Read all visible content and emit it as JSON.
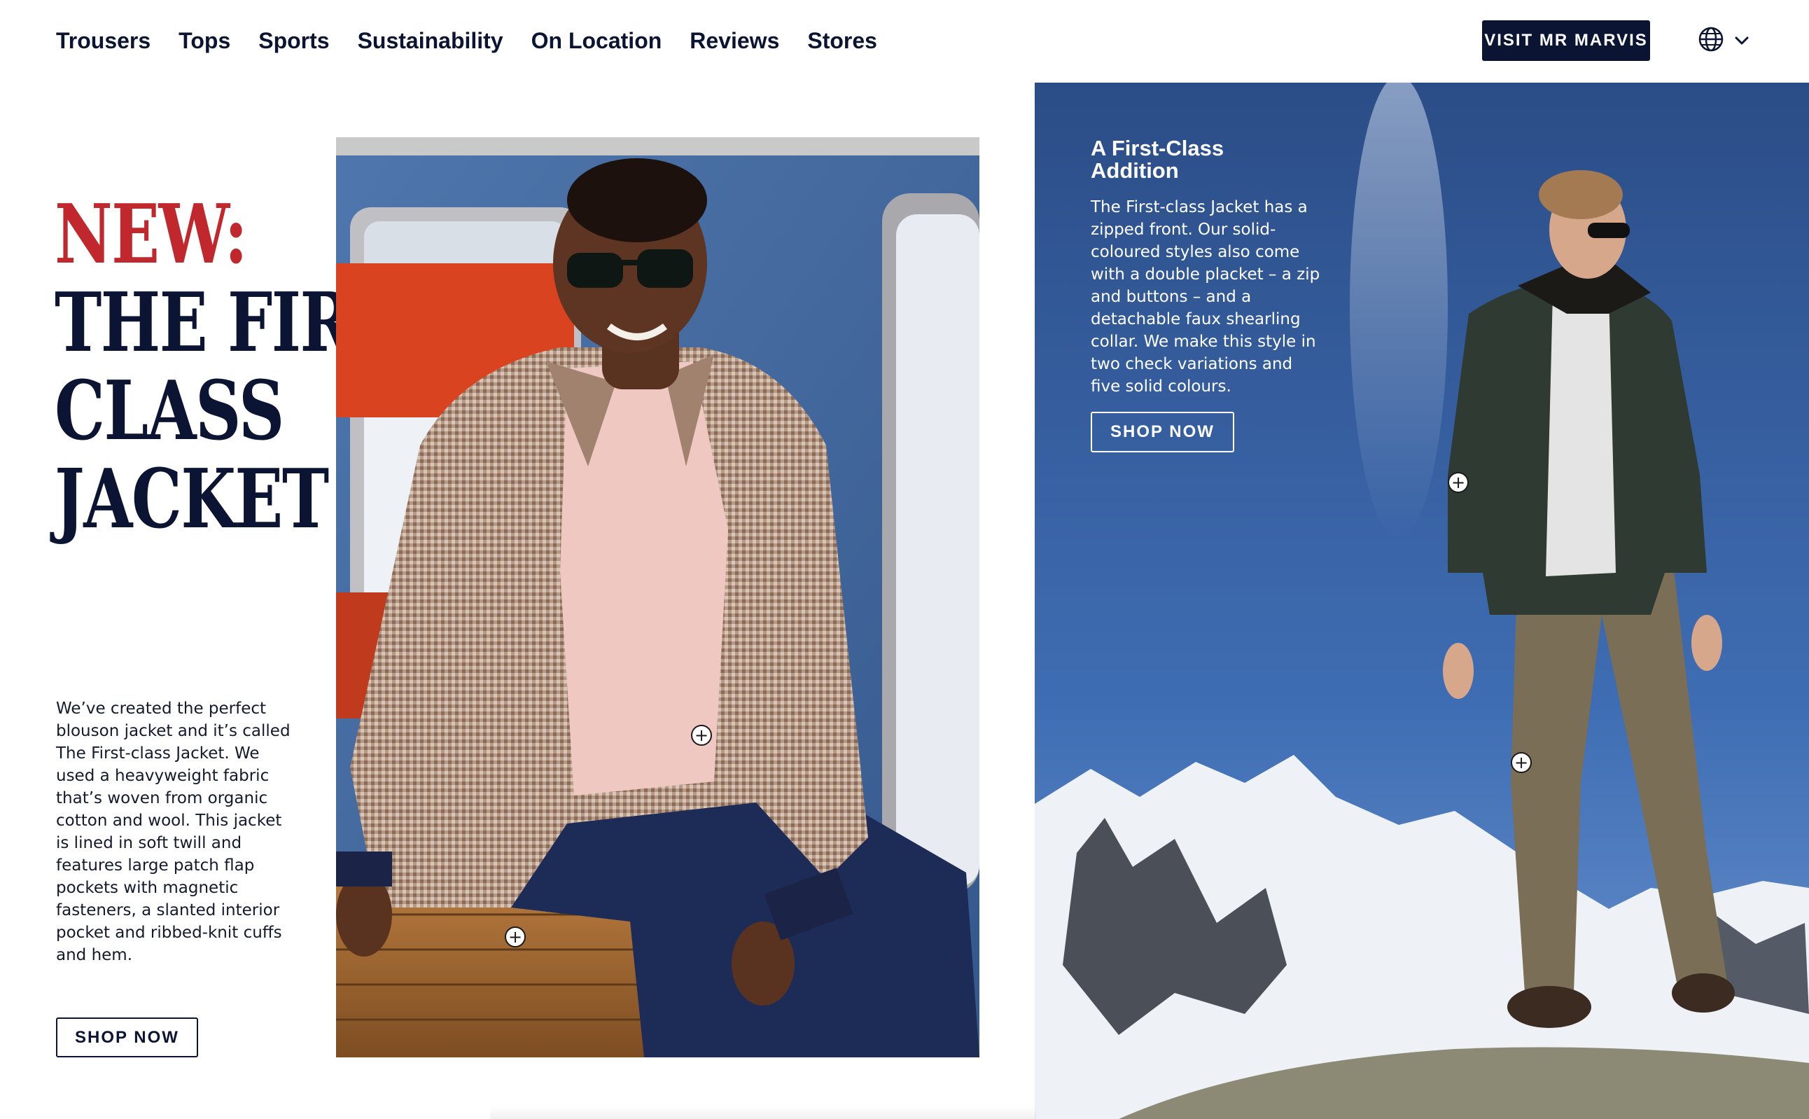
{
  "header": {
    "nav": [
      "Trousers",
      "Tops",
      "Sports",
      "Sustainability",
      "On Location",
      "Reviews",
      "Stores"
    ],
    "visit_button": "VISIT MR MARVIS",
    "language_icon": "globe-icon",
    "dropdown_icon": "chevron-down-icon"
  },
  "hero": {
    "title_accent": "NEW:",
    "title_line1": "THE FIRST-",
    "title_line2": "CLASS",
    "title_line3": "JACKET",
    "intro": "We’ve created the perfect blouson jacket and it’s called The First-class Jacket. We used a heavyweight fabric that’s woven from organic cotton and wool. This jacket is lined in soft twill and features large patch flap pockets with magnetic fasteners, a slanted interior pocket and ribbed-knit cuffs and hem.",
    "shop_button": "SHOP NOW"
  },
  "feature": {
    "heading": "A First-Class Addition",
    "body": "The First-class Jacket has a zipped front. Our solid-coloured styles also come with a double placket  – a zip and buttons – and a detachable faux shearling collar. We make this style in two check variations and five solid colours.",
    "shop_button": "SHOP NOW"
  },
  "hotspot_symbol": "+",
  "colors": {
    "navy": "#0b1533",
    "accent_red": "#c0282d",
    "white": "#ffffff"
  }
}
